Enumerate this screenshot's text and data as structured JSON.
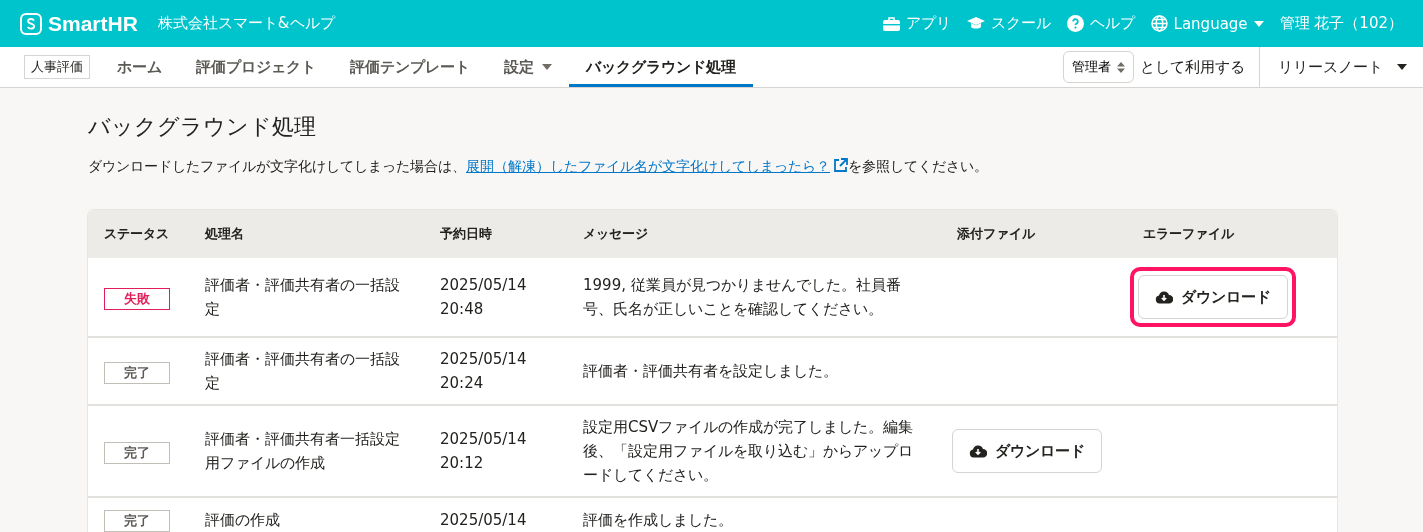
{
  "header": {
    "logo": "SmartHR",
    "company": "株式会社スマート&ヘルプ",
    "links": [
      {
        "kind": "apps",
        "label": "アプリ"
      },
      {
        "kind": "school",
        "label": "スクール"
      },
      {
        "kind": "help",
        "label": "ヘルプ"
      },
      {
        "kind": "language",
        "label": "Language"
      }
    ],
    "user": "管理 花子（102）"
  },
  "nav": {
    "app_badge": "人事評価",
    "items": [
      {
        "label": "ホーム",
        "selected": false,
        "dropdown": false
      },
      {
        "label": "評価プロジェクト",
        "selected": false,
        "dropdown": false
      },
      {
        "label": "評価テンプレート",
        "selected": false,
        "dropdown": false
      },
      {
        "label": "設定",
        "selected": false,
        "dropdown": true
      },
      {
        "label": "バックグラウンド処理",
        "selected": true,
        "dropdown": false
      }
    ],
    "role_select": "管理者",
    "role_suffix": "として利用する",
    "release_notes": "リリースノート"
  },
  "page": {
    "title": "バックグラウンド処理",
    "note_before": "ダウンロードしたファイルが文字化けしてしまった場合は、",
    "note_link": "展開（解凍）したファイル名が文字化けしてしまったら？",
    "note_after": "を参照してください。"
  },
  "table": {
    "columns": [
      "ステータス",
      "処理名",
      "予約日時",
      "メッセージ",
      "添付ファイル",
      "エラーファイル"
    ],
    "rows": [
      {
        "status": {
          "kind": "failed",
          "label": "失敗"
        },
        "name": "評価者・評価共有者の一括設定",
        "date": "2025/05/14",
        "time": "20:48",
        "message": "1999, 従業員が見つかりませんでした。社員番号、氏名が正しいことを確認してください。",
        "attachment": null,
        "error_file": {
          "label": "ダウンロード",
          "highlighted": true
        }
      },
      {
        "status": {
          "kind": "done",
          "label": "完了"
        },
        "name": "評価者・評価共有者の一括設定",
        "date": "2025/05/14",
        "time": "20:24",
        "message": "評価者・評価共有者を設定しました。",
        "attachment": null,
        "error_file": null
      },
      {
        "status": {
          "kind": "done",
          "label": "完了"
        },
        "name": "評価者・評価共有者一括設定用ファイルの作成",
        "date": "2025/05/14",
        "time": "20:12",
        "message": "設定用CSVファイルの作成が完了しました。編集後、「設定用ファイルを取り込む」からアップロードしてください。",
        "attachment": {
          "label": "ダウンロード",
          "highlighted": false
        },
        "error_file": null
      },
      {
        "status": {
          "kind": "done",
          "label": "完了"
        },
        "name": "評価の作成",
        "date": "2025/05/14",
        "message": "評価を作成しました。",
        "attachment": null,
        "error_file": null
      }
    ]
  }
}
